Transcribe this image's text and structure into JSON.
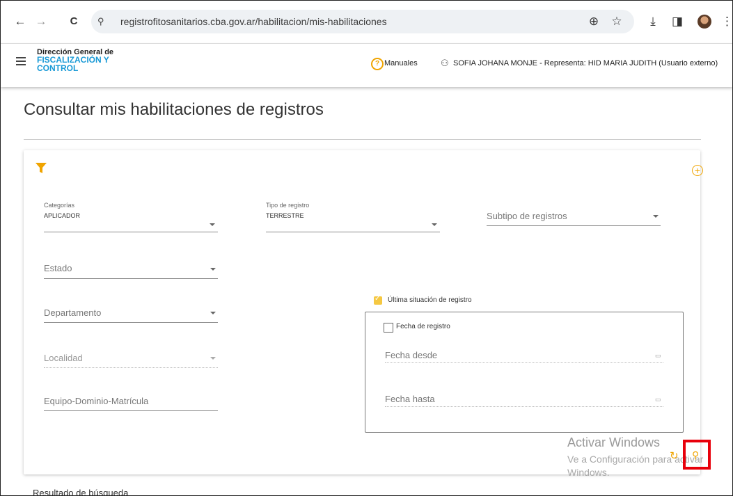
{
  "browser": {
    "url": "registrofitosanitarios.cba.gov.ar/habilitacion/mis-habilitaciones",
    "back_icon": "←",
    "forward_icon": "→",
    "reload_icon": "C",
    "site_settings_icon": "⚲",
    "zoom_icon": "⊕",
    "star_icon": "☆",
    "download_icon": "⤓",
    "sidepanel_icon": "◨",
    "more_icon": "⋮"
  },
  "header": {
    "brand_line1": "Dirección General de",
    "brand_line2": "FISCALIZACIÓN Y CONTROL",
    "manuales": "Manuales",
    "help_icon": "?",
    "user_icon": "⚇",
    "user": "SOFIA JOHANA MONJE - Representa: HID MARIA JUDITH (Usuario externo)"
  },
  "page": {
    "title": "Consultar mis habilitaciones de registros"
  },
  "filters": {
    "categorias": {
      "label": "Categorías",
      "value": "APLICADOR"
    },
    "tipo_registro": {
      "label": "Tipo de registro",
      "value": "TERRESTRE"
    },
    "subtipo_placeholder": "Subtipo de registros",
    "estado_placeholder": "Estado",
    "departamento_placeholder": "Departamento",
    "localidad_placeholder": "Localidad",
    "equipo_placeholder": "Equipo-Dominio-Matrícula",
    "ultima_situacion": {
      "label": "Última situación de registro",
      "checked": true
    },
    "fecha_registro": {
      "label": "Fecha de registro",
      "checked": false
    },
    "fecha_desde_placeholder": "Fecha desde",
    "fecha_hasta_placeholder": "Fecha hasta",
    "add_icon": "+",
    "refresh_icon": "↻",
    "search_icon": "⚲",
    "calendar_icon": "▭"
  },
  "watermark": {
    "line1": "Activar Windows",
    "line2": "Ve a Configuración para activar",
    "line3": "Windows."
  },
  "results": {
    "title": "Resultado de búsqueda"
  },
  "colors": {
    "accent": "#f0a400",
    "brand_blue": "#1a9ad6",
    "highlight": "#e8000b"
  }
}
